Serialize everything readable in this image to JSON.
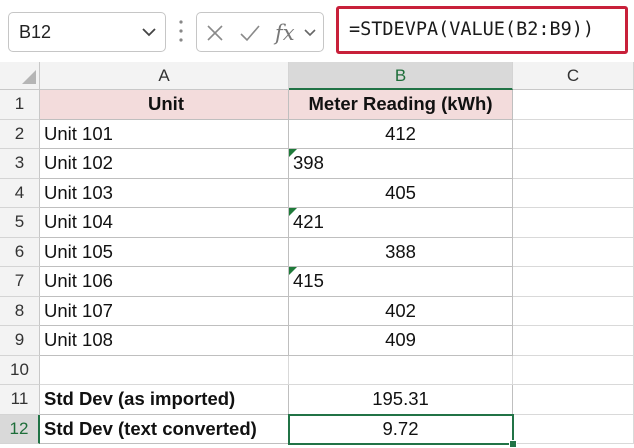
{
  "formula_bar": {
    "name_box": "B12",
    "formula": "=STDEVPA(VALUE(B2:B9))",
    "fx_label": "fx"
  },
  "columns": [
    "A",
    "B",
    "C"
  ],
  "rows": [
    {
      "num": "1",
      "a": "Unit",
      "b": "Meter Reading (kWh)",
      "text_num": false
    },
    {
      "num": "2",
      "a": "Unit 101",
      "b": "412",
      "text_num": false
    },
    {
      "num": "3",
      "a": "Unit 102",
      "b": "398",
      "text_num": true
    },
    {
      "num": "4",
      "a": "Unit 103",
      "b": "405",
      "text_num": false
    },
    {
      "num": "5",
      "a": "Unit 104",
      "b": "421",
      "text_num": true
    },
    {
      "num": "6",
      "a": "Unit 105",
      "b": "388",
      "text_num": false
    },
    {
      "num": "7",
      "a": "Unit 106",
      "b": "415",
      "text_num": true
    },
    {
      "num": "8",
      "a": "Unit 107",
      "b": "402",
      "text_num": false
    },
    {
      "num": "9",
      "a": "Unit 108",
      "b": "409",
      "text_num": false
    },
    {
      "num": "10",
      "a": "",
      "b": "",
      "text_num": false
    },
    {
      "num": "11",
      "a": "Std Dev (as imported)",
      "b": "195.31",
      "text_num": false
    },
    {
      "num": "12",
      "a": "Std Dev (text converted)",
      "b": "9.72",
      "text_num": false
    }
  ],
  "colors": {
    "header_fill": "#f3dcdc",
    "selection_green": "#217346",
    "formula_highlight": "#c8203a"
  }
}
